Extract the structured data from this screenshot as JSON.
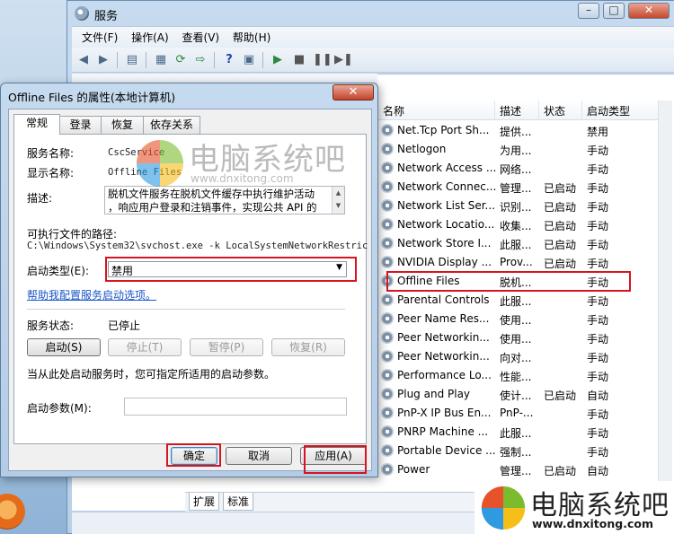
{
  "services_window": {
    "title": "服务",
    "menu": [
      "文件(F)",
      "操作(A)",
      "查看(V)",
      "帮助(H)"
    ],
    "columns": [
      "名称",
      "描述",
      "状态",
      "启动类型"
    ],
    "rows": [
      {
        "name": "Net.Tcp Port Sh...",
        "desc": "提供...",
        "state": "",
        "type": "禁用"
      },
      {
        "name": "Netlogon",
        "desc": "为用...",
        "state": "",
        "type": "手动"
      },
      {
        "name": "Network Access ...",
        "desc": "网络...",
        "state": "",
        "type": "手动"
      },
      {
        "name": "Network Connec...",
        "desc": "管理...",
        "state": "已启动",
        "type": "手动"
      },
      {
        "name": "Network List Ser...",
        "desc": "识别...",
        "state": "已启动",
        "type": "手动"
      },
      {
        "name": "Network Locatio...",
        "desc": "收集...",
        "state": "已启动",
        "type": "手动"
      },
      {
        "name": "Network Store I...",
        "desc": "此服...",
        "state": "已启动",
        "type": "手动"
      },
      {
        "name": "NVIDIA Display ...",
        "desc": "Prov...",
        "state": "已启动",
        "type": "手动"
      },
      {
        "name": "Offline Files",
        "desc": "脱机...",
        "state": "",
        "type": "手动"
      },
      {
        "name": "Parental Controls",
        "desc": "此服...",
        "state": "",
        "type": "手动"
      },
      {
        "name": "Peer Name Res...",
        "desc": "使用...",
        "state": "",
        "type": "手动"
      },
      {
        "name": "Peer Networkin...",
        "desc": "使用...",
        "state": "",
        "type": "手动"
      },
      {
        "name": "Peer Networkin...",
        "desc": "向对...",
        "state": "",
        "type": "手动"
      },
      {
        "name": "Performance Lo...",
        "desc": "性能...",
        "state": "",
        "type": "手动"
      },
      {
        "name": "Plug and Play",
        "desc": "使计...",
        "state": "已启动",
        "type": "自动"
      },
      {
        "name": "PnP-X IP Bus En...",
        "desc": "PnP-...",
        "state": "",
        "type": "手动"
      },
      {
        "name": "PNRP Machine ...",
        "desc": "此服...",
        "state": "",
        "type": "手动"
      },
      {
        "name": "Portable Device ...",
        "desc": "强制...",
        "state": "",
        "type": "手动"
      },
      {
        "name": "Power",
        "desc": "管理...",
        "state": "已启动",
        "type": "自动"
      }
    ],
    "bottom_tabs": [
      "扩展",
      "标准"
    ]
  },
  "dialog": {
    "title": "Offline Files 的属性(本地计算机)",
    "close": "✕",
    "tabs": [
      "常规",
      "登录",
      "恢复",
      "依存关系"
    ],
    "service_name_label": "服务名称:",
    "service_name": "CscService",
    "display_name_label": "显示名称:",
    "display_name": "Offline Files",
    "desc_label": "描述:",
    "desc_line1": "脱机文件服务在脱机文件缓存中执行维护活动",
    "desc_line2": "，响应用户登录和注销事件，实现公共 API 的",
    "path_label": "可执行文件的路径:",
    "path": "C:\\Windows\\System32\\svchost.exe -k LocalSystemNetworkRestric",
    "startup_label": "启动类型(E):",
    "startup_value": "禁用",
    "help_link": "帮助我配置服务启动选项。",
    "status_label": "服务状态:",
    "status_value": "已停止",
    "buttons": {
      "start": "启动(S)",
      "stop": "停止(T)",
      "pause": "暂停(P)",
      "resume": "恢复(R)"
    },
    "hint": "当从此处启动服务时，您可指定所适用的启动参数。",
    "param_label": "启动参数(M):",
    "ok": "确定",
    "cancel": "取消",
    "apply": "应用(A)"
  },
  "watermark": {
    "title": "电脑系统吧",
    "site": "www.dnxitong.com"
  }
}
